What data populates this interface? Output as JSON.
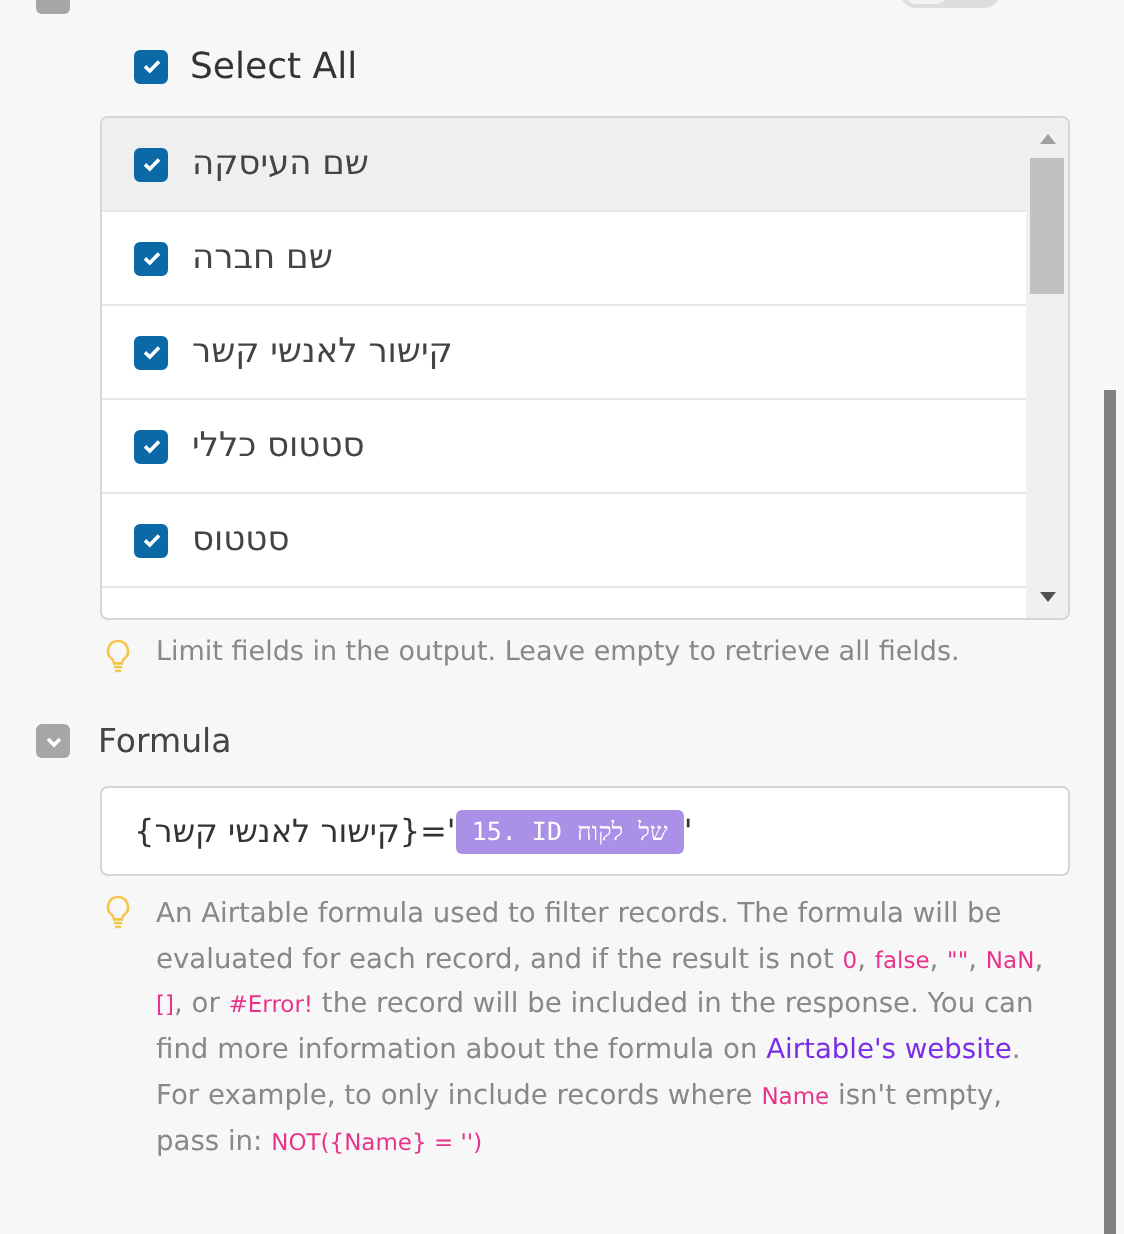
{
  "output_fields": {
    "toggle": {
      "on": false
    },
    "select_all": {
      "label": "Select All",
      "checked": true
    },
    "items": [
      {
        "label": "שם העיסקה",
        "checked": true,
        "highlighted": true
      },
      {
        "label": "שם חברה",
        "checked": true,
        "highlighted": false
      },
      {
        "label": "קישור לאנשי קשר",
        "checked": true,
        "highlighted": false
      },
      {
        "label": "סטטוס כללי",
        "checked": true,
        "highlighted": false
      },
      {
        "label": "סטטוס",
        "checked": true,
        "highlighted": false
      }
    ],
    "hint": "Limit fields in the output. Leave empty to retrieve all fields."
  },
  "formula": {
    "title": "Formula",
    "expanded": true,
    "value": {
      "prefix": "{קישור לאנשי קשר}='",
      "chip": "15. ID של לקוח",
      "suffix": "'"
    },
    "description": [
      {
        "kind": "text",
        "text": "An Airtable formula used to filter records. The formula will be evaluated for each record, and if the result is not "
      },
      {
        "kind": "code",
        "text": "0"
      },
      {
        "kind": "text",
        "text": ", "
      },
      {
        "kind": "code",
        "text": "false"
      },
      {
        "kind": "text",
        "text": ", "
      },
      {
        "kind": "code",
        "text": "\"\""
      },
      {
        "kind": "text",
        "text": ", "
      },
      {
        "kind": "code",
        "text": "NaN"
      },
      {
        "kind": "text",
        "text": ", "
      },
      {
        "kind": "code",
        "text": "[]"
      },
      {
        "kind": "text",
        "text": ", or "
      },
      {
        "kind": "code",
        "text": "#Error!"
      },
      {
        "kind": "text",
        "text": " the record will be included in the response. You can find more information about the formula on "
      },
      {
        "kind": "link",
        "text": "Airtable's website"
      },
      {
        "kind": "text",
        "text": ". For example, to only include records where "
      },
      {
        "kind": "code",
        "text": "Name"
      },
      {
        "kind": "text",
        "text": " isn't empty, pass in: "
      },
      {
        "kind": "code",
        "text": "NOT({Name} = '')"
      }
    ]
  }
}
